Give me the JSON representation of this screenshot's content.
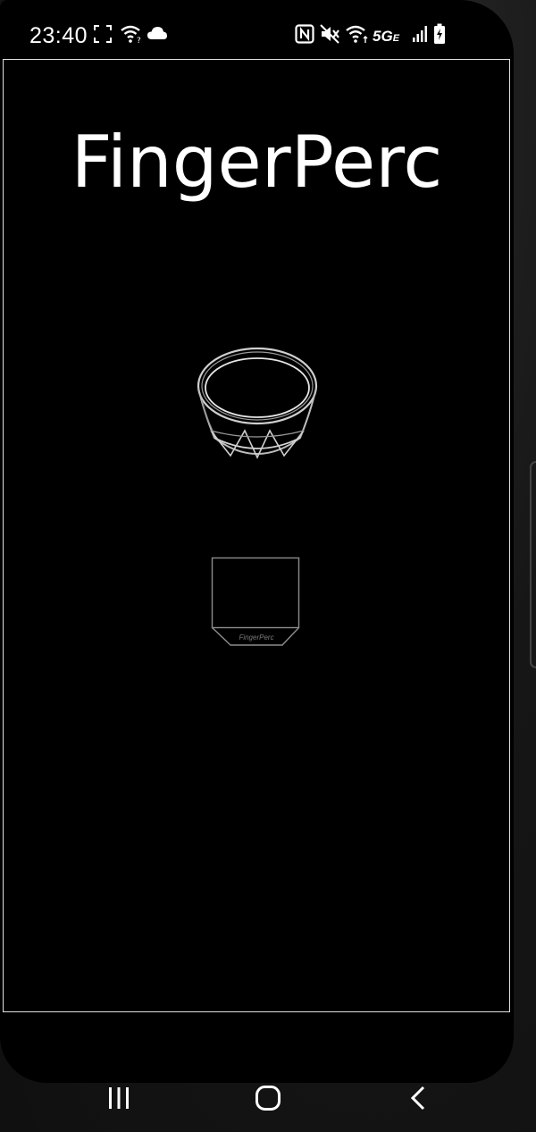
{
  "status_bar": {
    "time": "23:40",
    "network": "5G",
    "network_sub": "E",
    "left_icons": [
      "screenshot-icon",
      "wifi-question-icon",
      "cloud-icon"
    ],
    "right_icons": [
      "nfc-icon",
      "mute-icon",
      "wifi-icon",
      "signal-icon",
      "battery-charging-icon"
    ]
  },
  "app": {
    "title": "FingerPerc",
    "pad_label": "FingerPerc"
  },
  "nav": {
    "buttons": [
      "recents",
      "home",
      "back"
    ]
  }
}
